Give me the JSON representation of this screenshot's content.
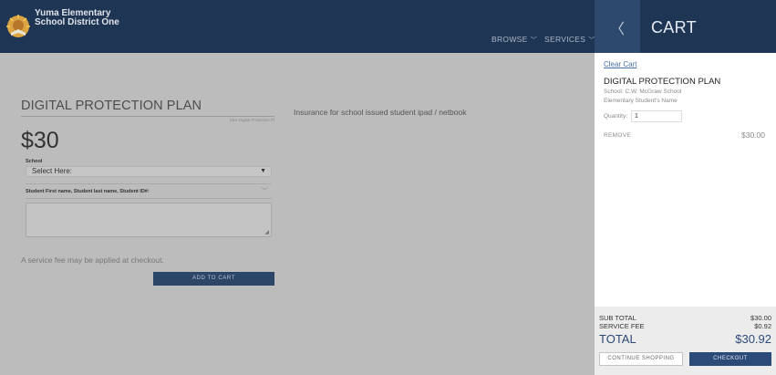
{
  "header": {
    "brand_line1": "Yuma Elementary",
    "brand_line2": "School District One",
    "nav": [
      {
        "label": "BROWSE"
      },
      {
        "label": "SERVICES"
      }
    ]
  },
  "product": {
    "title": "DIGITAL PROTECTION PLAN",
    "sku": "Idex Digital Protection Pl",
    "price": "$30",
    "description": "Insurance for school issued student ipad / netbook",
    "school_label": "School",
    "school_select_value": "Select Here:",
    "student_label": "Student First name, Student last name, Student ID#:",
    "service_fee_note": "A service fee may be applied at checkout.",
    "add_to_cart": "ADD TO CART"
  },
  "cart": {
    "title": "CART",
    "clear": "Clear Cart",
    "item": {
      "name": "DIGITAL PROTECTION PLAN",
      "school": "School: C.W. McGraw School",
      "student": "Elementary Student's Name",
      "quantity_label": "Quantity:",
      "quantity": "1",
      "remove": "REMOVE",
      "price": "$30.00"
    },
    "summary": {
      "subtotal_label": "SUB TOTAL",
      "subtotal": "$30.00",
      "fee_label": "SERVICE FEE",
      "fee": "$0.92",
      "total_label": "TOTAL",
      "total": "$30.92"
    },
    "continue_shopping": "CONTINUE SHOPPING",
    "checkout": "CHECKOUT"
  },
  "colors": {
    "navy": "#1f3554",
    "accent_blue": "#2c4a78",
    "overlay_grey": "#bcbcbc"
  },
  "icons": {
    "logo": "sun-school-logo",
    "chevron": "chevron-down-icon",
    "back": "chevron-left-icon"
  }
}
